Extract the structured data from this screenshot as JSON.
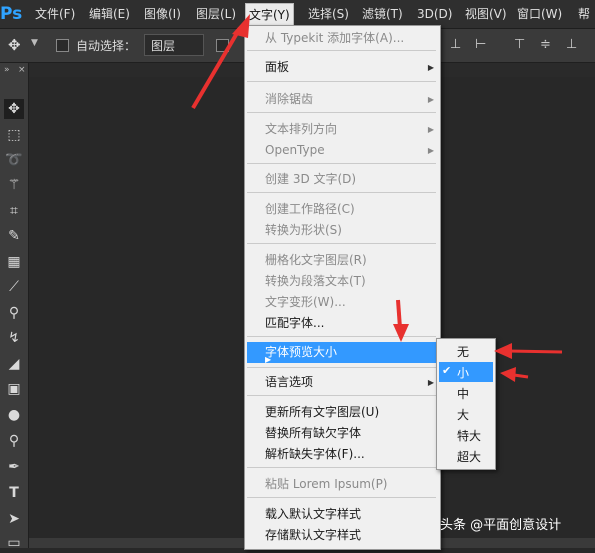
{
  "app_logo": "Ps",
  "menubar": {
    "items": [
      "文件(F)",
      "编辑(E)",
      "图像(I)",
      "图层(L)",
      "文字(Y)",
      "选择(S)",
      "滤镜(T)",
      "3D(D)",
      "视图(V)",
      "窗口(W)",
      "帮"
    ]
  },
  "options": {
    "auto_select_label": "自动选择：",
    "auto_select_value": "图层"
  },
  "type_menu": {
    "items": [
      "从 Typekit 添加字体(A)...",
      "面板",
      "消除锯齿",
      "文本排列方向",
      "OpenType",
      "创建 3D 文字(D)",
      "创建工作路径(C)",
      "转换为形状(S)",
      "栅格化文字图层(R)",
      "转换为段落文本(T)",
      "文字变形(W)...",
      "匹配字体...",
      "字体预览大小",
      "语言选项",
      "更新所有文字图层(U)",
      "替换所有缺欠字体",
      "解析缺失字体(F)...",
      "粘贴 Lorem Ipsum(P)",
      "载入默认文字样式",
      "存储默认文字样式"
    ]
  },
  "size_submenu": {
    "items": [
      "无",
      "小",
      "中",
      "大",
      "特大",
      "超大"
    ],
    "checked": "小"
  },
  "watermark": "头条 @平面创意设计",
  "colors": {
    "highlight": "#3399ff",
    "arrow": "#e8312f",
    "ps_blue": "#2fa3ff"
  }
}
